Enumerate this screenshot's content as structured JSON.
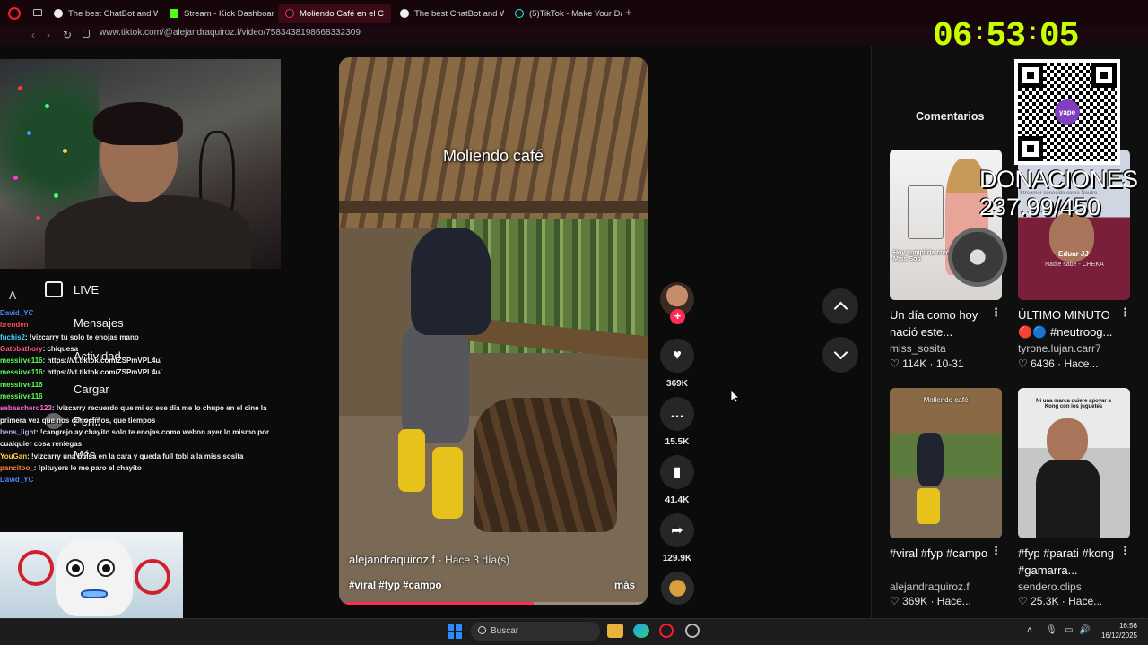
{
  "browser": {
    "tabs": [
      {
        "label": "The best ChatBot and Wr",
        "active": false
      },
      {
        "label": "Stream - Kick Dashboard",
        "active": false
      },
      {
        "label": "Moliendo Café en el C",
        "active": true
      },
      {
        "label": "The best ChatBot and Wr",
        "active": false
      },
      {
        "label": "(5)TikTok - Make Your Da",
        "active": false
      }
    ],
    "new_tab": "+",
    "url": "www.tiktok.com/@alejandraquiroz.f/video/7583438198668332309"
  },
  "stream_overlay": {
    "clock": {
      "h": "06",
      "m": "53",
      "s": "05"
    },
    "donations_label": "DONACIONES",
    "donations_value": "237.99/450",
    "qr_logo": "yape",
    "now_playing": {
      "artist": "Eduar JJ",
      "song": "Nadie sabe - CHEKA"
    }
  },
  "left_nav": [
    {
      "label": "LIVE",
      "icon": "live-tv-icon"
    },
    {
      "label": "Mensajes",
      "icon": "message-icon"
    },
    {
      "label": "Actividad",
      "icon": "activity-icon"
    },
    {
      "label": "Cargar",
      "icon": "upload-icon"
    },
    {
      "label": "Perfil",
      "icon": "profile-icon"
    },
    {
      "label": "Más",
      "icon": "more-icon"
    }
  ],
  "chat": [
    {
      "user": "David_YC",
      "text": "",
      "color": "#4f8cff"
    },
    {
      "user": "brenden",
      "text": "",
      "color": "#ff4d4d"
    },
    {
      "user": "fuchis2",
      "text": "!vizcarry tu solo te enojas mano",
      "color": "#4fd1ff"
    },
    {
      "user": "Gatobathory",
      "text": "chiquesa",
      "color": "#ff5a8a"
    },
    {
      "user": "messirve116",
      "text": "https://vt.tiktok.com/ZSPmVPL4u/",
      "color": "#61ff61"
    },
    {
      "user": "messirve116",
      "text": "https://vt.tiktok.com/ZSPmVPL4u/",
      "color": "#61ff61"
    },
    {
      "user": "messirve116",
      "text": "",
      "color": "#61ff61"
    },
    {
      "user": "messirve116",
      "text": "",
      "color": "#61ff61"
    },
    {
      "user": "sebaschero123",
      "text": "!vizcarry recuerdo que mi ex ese día me lo chupo en el cine la primera vez que nos conocimos, que tiempos",
      "color": "#ff6fd8"
    },
    {
      "user": "bens_light",
      "text": "!cangrejo ay chayito solo te enojas como webon ayer lo mismo por cualquier cosa reniegas",
      "color": "#c9a8ff"
    },
    {
      "user": "YouGan",
      "text": "!vizcarry una bolsa en la cara y queda full tobi a la miss sosita",
      "color": "#ffd24d"
    },
    {
      "user": "pancitoo_",
      "text": "!pituyers le me paro el chayito",
      "color": "#ff8c3a"
    },
    {
      "user": "David_YC",
      "text": "",
      "color": "#4f8cff"
    }
  ],
  "video": {
    "overlay_title": "Moliendo café",
    "author": "alejandraquiroz.f",
    "ago": "· Hace 3 día(s)",
    "tags": "#viral #fyp #campo",
    "more": "más",
    "progress": 0.63
  },
  "actions": {
    "likes": "369K",
    "comments": "15.5K",
    "saves": "41.4K",
    "shares": "129.9K"
  },
  "right_panel": {
    "title": "Comentarios",
    "cards": [
      {
        "title": "Un día como hoy nació este...",
        "user": "miss_sosita",
        "meta": "♡ 114K · 10-31",
        "thumb_text": "Hoy cumpliría creó Miss Sos"
      },
      {
        "title": "ÚLTIMO MINUTO 🔴🔵 #neutroog...",
        "user": "tyrone.lujan.carr7",
        "meta": "♡ 6436 · Hace...",
        "thumb_text": "Streamer conocido como Neutro"
      },
      {
        "title": "#viral #fyp #campo",
        "user": "alejandraquiroz.f",
        "meta": "♡ 369K · Hace...",
        "thumb_text": "Moliendo café"
      },
      {
        "title": "#fyp #parati #kong #gamarra...",
        "user": "sendero.clips",
        "meta": "♡ 25.3K · Hace...",
        "thumb_text": "Ni una marca quiere apoyar a Kong con los juguetes"
      }
    ]
  },
  "taskbar": {
    "search_placeholder": "Buscar",
    "time": "16:56",
    "date": "16/12/2025"
  },
  "colors": {
    "accent": "#fe2c55",
    "clock": "#c6ff00",
    "browser_bg": "#16060a"
  }
}
